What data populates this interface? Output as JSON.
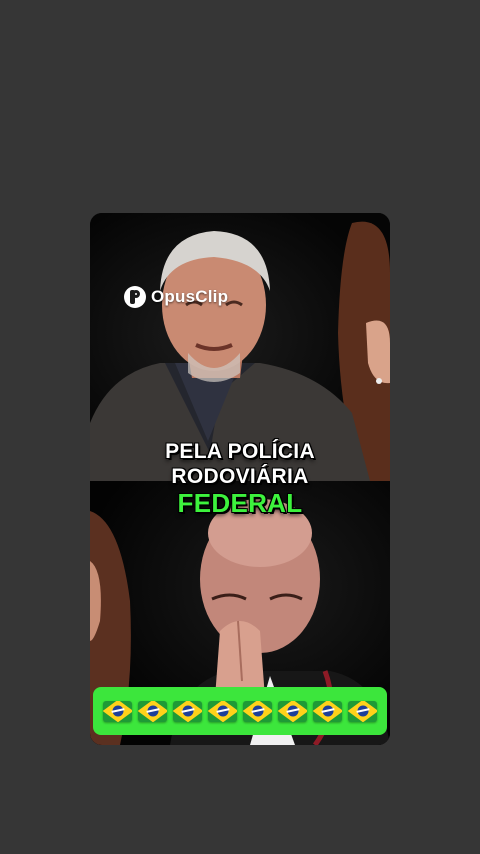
{
  "watermark": {
    "brand": "OpusClip",
    "logo_icon": "opusclip-logo-icon"
  },
  "caption": {
    "line1": "PELA POLÍCIA",
    "line2": "RODOVIÁRIA",
    "line3": "FEDERAL",
    "highlight_color": "#3df23d"
  },
  "emoji_bar": {
    "background": "#3ce63c",
    "icon": "brazil-flag-icon",
    "count": 8
  },
  "colors": {
    "page_background": "#363636",
    "card_background": "#000000"
  }
}
